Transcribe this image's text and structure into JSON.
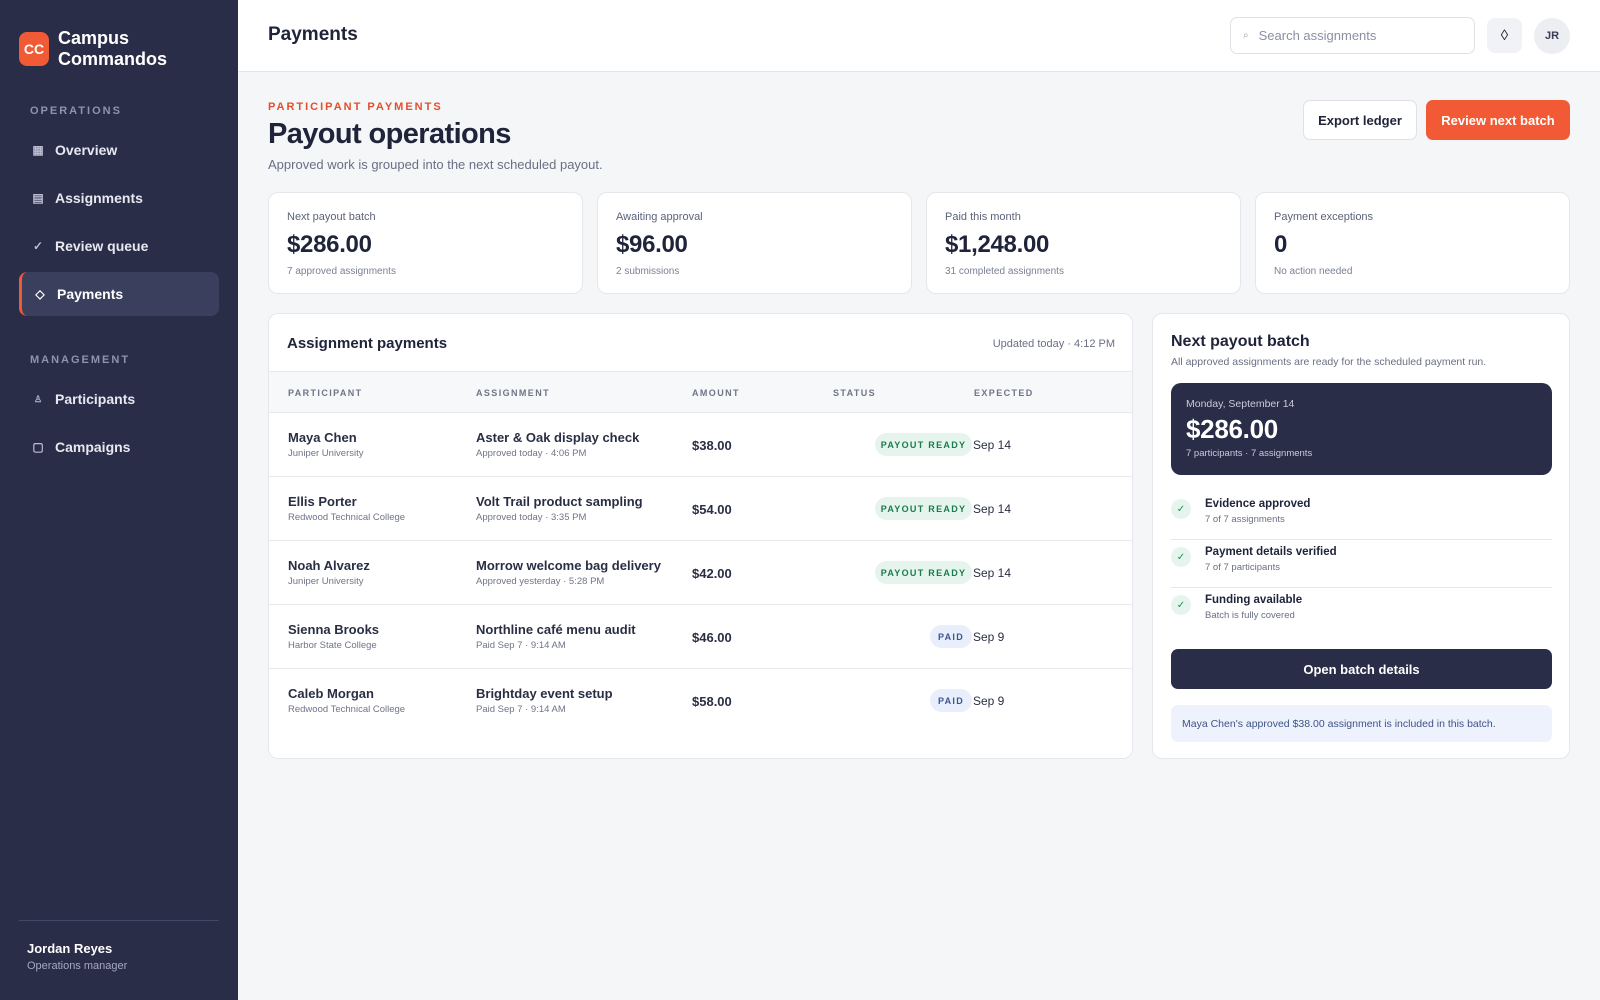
{
  "brand": {
    "logo": "CC",
    "name": "Campus Commandos"
  },
  "sidebar": {
    "sections": [
      {
        "label": "OPERATIONS"
      },
      {
        "label": "MANAGEMENT"
      }
    ],
    "items": [
      {
        "label": "Overview",
        "icon": "grid-icon"
      },
      {
        "label": "Assignments",
        "icon": "list-icon"
      },
      {
        "label": "Review queue",
        "icon": "check-icon"
      },
      {
        "label": "Payments",
        "icon": "diamond-icon",
        "active": true
      },
      {
        "label": "Participants",
        "icon": "person-icon"
      },
      {
        "label": "Campaigns",
        "icon": "square-icon"
      }
    ],
    "user": {
      "name": "Jordan Reyes",
      "role": "Operations manager"
    }
  },
  "topbar": {
    "title": "Payments",
    "search_placeholder": "Search assignments",
    "avatar": "JR"
  },
  "header": {
    "eyebrow": "PARTICIPANT PAYMENTS",
    "title": "Payout operations",
    "subtitle": "Approved work is grouped into the next scheduled payout.",
    "export_label": "Export ledger",
    "review_label": "Review next batch"
  },
  "stats": [
    {
      "label": "Next payout batch",
      "value": "$286.00",
      "sub": "7 approved assignments"
    },
    {
      "label": "Awaiting approval",
      "value": "$96.00",
      "sub": "2 submissions"
    },
    {
      "label": "Paid this month",
      "value": "$1,248.00",
      "sub": "31 completed assignments"
    },
    {
      "label": "Payment exceptions",
      "value": "0",
      "sub": "No action needed"
    }
  ],
  "table": {
    "title": "Assignment payments",
    "updated": "Updated today · 4:12 PM",
    "columns": [
      "PARTICIPANT",
      "ASSIGNMENT",
      "AMOUNT",
      "STATUS",
      "EXPECTED"
    ],
    "rows": [
      {
        "name": "Maya Chen",
        "school": "Juniper University",
        "assignment": "Aster & Oak display check",
        "meta": "Approved today · 4:06 PM",
        "amount": "$38.00",
        "status": "PAYOUT READY",
        "expected": "Sep 14"
      },
      {
        "name": "Ellis Porter",
        "school": "Redwood Technical College",
        "assignment": "Volt Trail product sampling",
        "meta": "Approved today · 3:35 PM",
        "amount": "$54.00",
        "status": "PAYOUT READY",
        "expected": "Sep 14"
      },
      {
        "name": "Noah Alvarez",
        "school": "Juniper University",
        "assignment": "Morrow welcome bag delivery",
        "meta": "Approved yesterday · 5:28 PM",
        "amount": "$42.00",
        "status": "PAYOUT READY",
        "expected": "Sep 14"
      },
      {
        "name": "Sienna Brooks",
        "school": "Harbor State College",
        "assignment": "Northline café menu audit",
        "meta": "Paid Sep 7 · 9:14 AM",
        "amount": "$46.00",
        "status": "PAID",
        "expected": "Sep 9"
      },
      {
        "name": "Caleb Morgan",
        "school": "Redwood Technical College",
        "assignment": "Brightday event setup",
        "meta": "Paid Sep 7 · 9:14 AM",
        "amount": "$58.00",
        "status": "PAID",
        "expected": "Sep 9"
      }
    ]
  },
  "batch": {
    "title": "Next payout batch",
    "subtitle": "All approved assignments are ready for the scheduled payment run.",
    "date": "Monday, September 14",
    "amount": "$286.00",
    "meta": "7 participants · 7 assignments",
    "checks": [
      {
        "title": "Evidence approved",
        "sub": "7 of 7 assignments"
      },
      {
        "title": "Payment details verified",
        "sub": "7 of 7 participants"
      },
      {
        "title": "Funding available",
        "sub": "Batch is fully covered"
      }
    ],
    "button_label": "Open batch details",
    "note": "Maya Chen's approved $38.00 assignment is included in this batch."
  },
  "colors": {
    "accent": "#f15a34",
    "sidebar": "#2a2d47",
    "ready_badge": "#e5f5ee",
    "paid_badge": "#e8eefb"
  }
}
